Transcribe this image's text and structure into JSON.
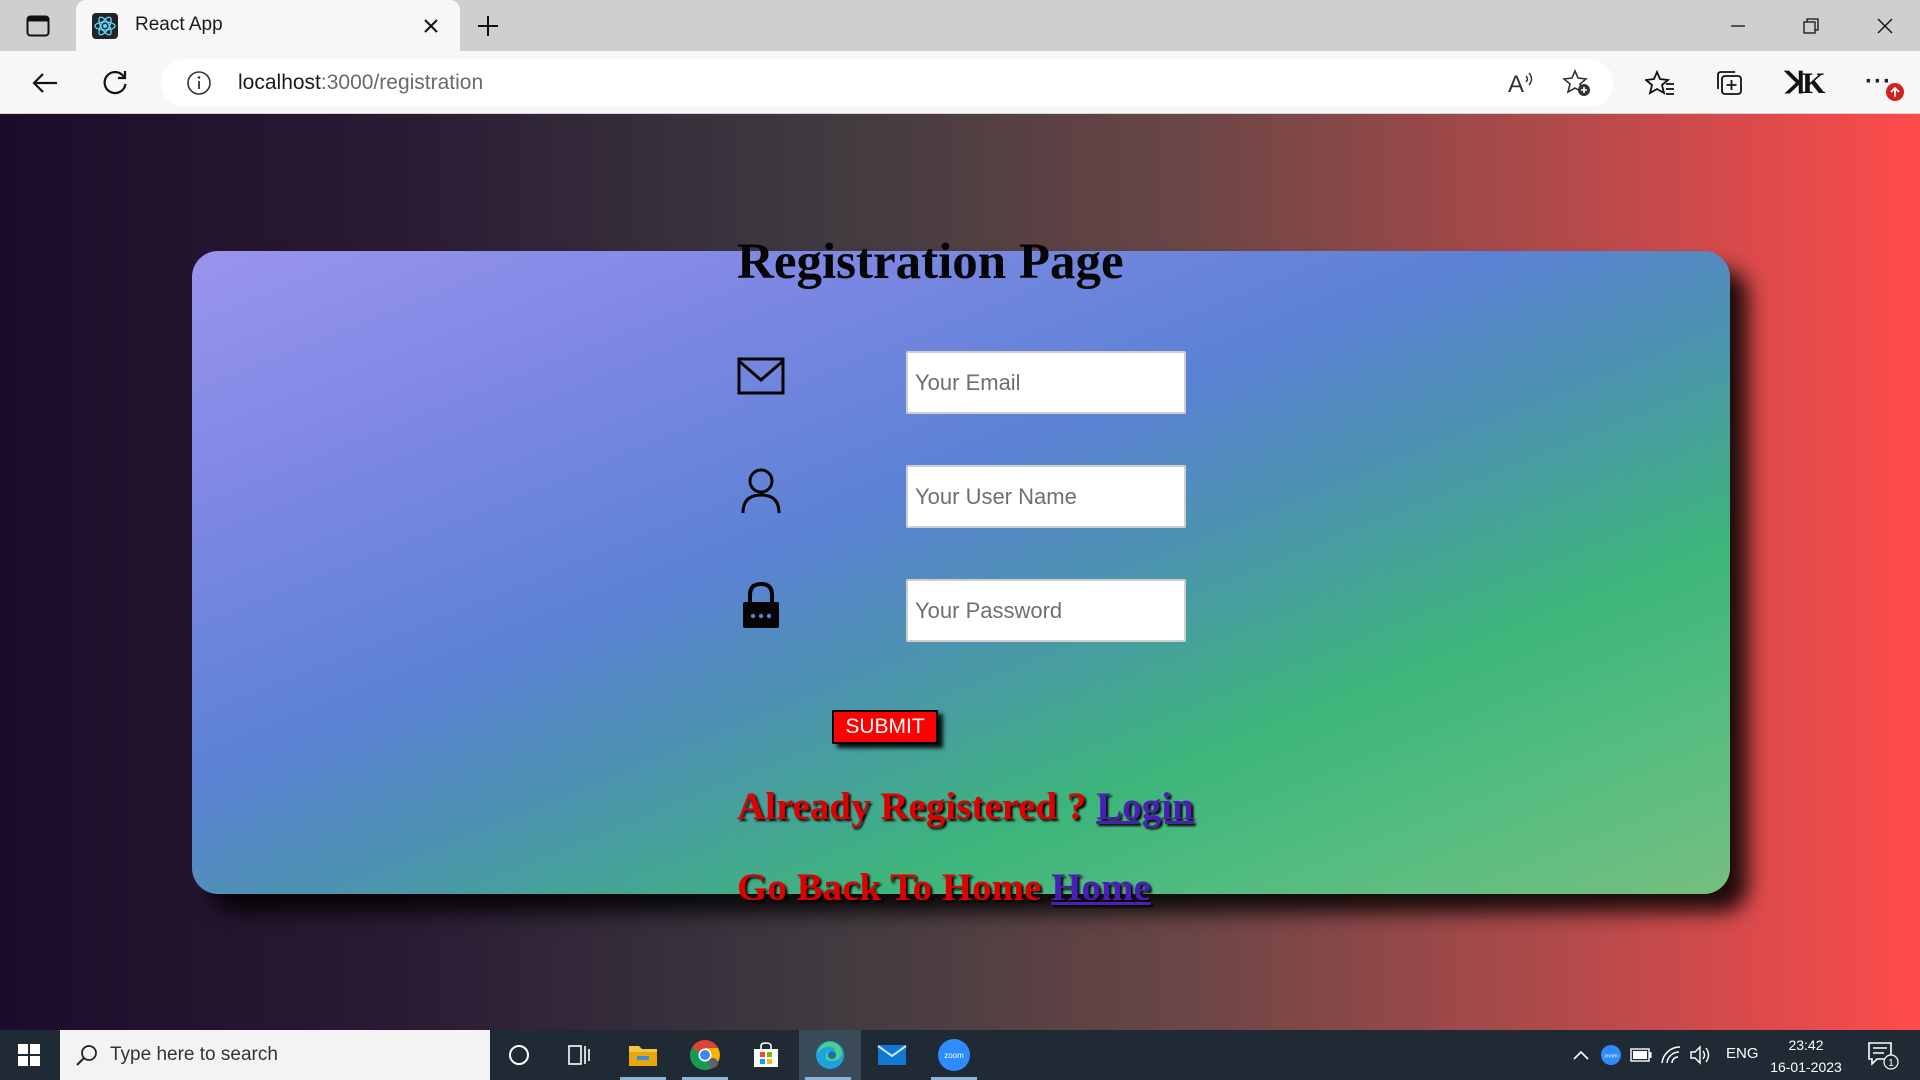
{
  "browser": {
    "tab_title": "React App",
    "address_host": "localhost",
    "address_path": ":3000/registration",
    "profile_initials": "ꓘK",
    "more_label": "···"
  },
  "page": {
    "title": "Registration Page",
    "email_placeholder": "Your Email",
    "username_placeholder": "Your User Name",
    "password_placeholder": "Your Password",
    "submit_label": "SUBMIT",
    "already_registered_text": "Already Registered ? ",
    "login_link": "Login",
    "go_back_text": "Go Back To Home ",
    "home_link": "Home",
    "colors": {
      "bg_left": "#1c0c2a",
      "bg_right": "#ff4b4b",
      "card_top": "#9994ee",
      "card_bottom": "#3db57b",
      "submit_bg": "#ff0000",
      "link_text": "#e00000",
      "link_anchor": "#4b1fb5"
    }
  },
  "taskbar": {
    "search_placeholder": "Type here to search",
    "apps": [
      "cortana",
      "task-view",
      "file-explorer",
      "chrome",
      "store",
      "edge",
      "mail",
      "zoom"
    ],
    "language": "ENG",
    "time": "23:42",
    "date": "16-01-2023",
    "notification_count": "1"
  }
}
